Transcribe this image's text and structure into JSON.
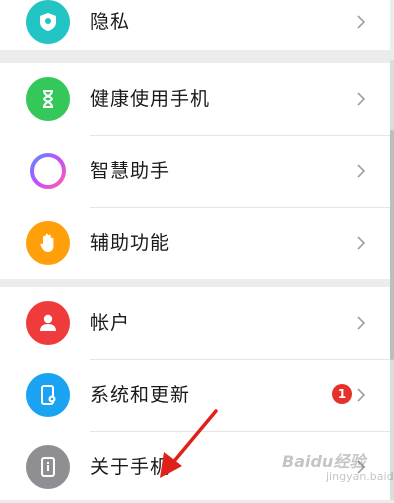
{
  "groups": [
    {
      "items": [
        {
          "label": "隐私",
          "icon": "privacy-shield-icon",
          "color": "#23c4c4"
        }
      ]
    },
    {
      "items": [
        {
          "label": "健康使用手机",
          "icon": "hourglass-icon",
          "color": "#34c759"
        },
        {
          "label": "智慧助手",
          "icon": "assistant-ring-icon",
          "color": "#a05cff"
        },
        {
          "label": "辅助功能",
          "icon": "hand-icon",
          "color": "#ff9f0a"
        }
      ]
    },
    {
      "items": [
        {
          "label": "帐户",
          "icon": "account-person-icon",
          "color": "#ef3b3b"
        },
        {
          "label": "系统和更新",
          "icon": "phone-settings-icon",
          "color": "#1aa3f2",
          "badge": "1"
        },
        {
          "label": "关于手机",
          "icon": "phone-info-icon",
          "color": "#8e8e93"
        }
      ]
    }
  ],
  "watermark": {
    "text": "Baidu经验",
    "sub": "jingyan.baidu.com"
  },
  "annotation": {
    "color": "#e0211a"
  }
}
